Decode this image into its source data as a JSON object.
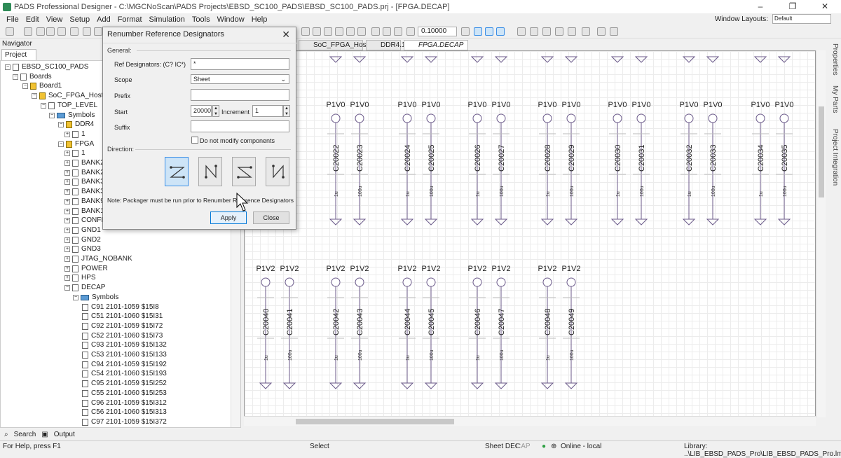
{
  "window": {
    "title": "PADS Professional Designer - C:\\MGCNoScan\\PADS Projects\\EBSD_SC100_PADS\\EBSD_SC100_PADS.prj - [FPGA.DECAP]",
    "minimize": "–",
    "maximize": "❐",
    "close": "✕"
  },
  "menu": [
    "File",
    "Edit",
    "View",
    "Setup",
    "Add",
    "Format",
    "Simulation",
    "Tools",
    "Window",
    "Help"
  ],
  "window_layouts": {
    "label": "Window Layouts:",
    "value": "Default"
  },
  "toolbar": {
    "zoom_value": "0.10000"
  },
  "navigator": {
    "title": "Navigator",
    "tab": "Project",
    "search_label": "Search",
    "output_label": "Output",
    "tree": [
      {
        "label": "EBSD_SC100_PADS",
        "indent": 0,
        "tw": "−",
        "icon": "project"
      },
      {
        "label": "Boards",
        "indent": 1,
        "tw": "−",
        "icon": "folder"
      },
      {
        "label": "Board1",
        "indent": 2,
        "tw": "−",
        "icon": "board"
      },
      {
        "label": "SoC_FPGA_Host",
        "indent": 3,
        "tw": "−",
        "icon": "block"
      },
      {
        "label": "TOP_LEVEL",
        "indent": 4,
        "tw": "−",
        "icon": "sheet"
      },
      {
        "label": "Symbols",
        "indent": 5,
        "tw": "−",
        "icon": "symbols"
      },
      {
        "label": "DDR4",
        "indent": 6,
        "tw": "−",
        "icon": "block"
      },
      {
        "label": "1",
        "indent": 7,
        "tw": "+",
        "icon": "sheet"
      },
      {
        "label": "FPGA",
        "indent": 6,
        "tw": "−",
        "icon": "block"
      },
      {
        "label": "1",
        "indent": 7,
        "tw": "+",
        "icon": "sheet"
      },
      {
        "label": "BANK2_",
        "indent": 7,
        "tw": "+",
        "icon": "sheet"
      },
      {
        "label": "BANK2_",
        "indent": 7,
        "tw": "+",
        "icon": "sheet"
      },
      {
        "label": "BANK3_",
        "indent": 7,
        "tw": "+",
        "icon": "sheet"
      },
      {
        "label": "BANK3_",
        "indent": 7,
        "tw": "+",
        "icon": "sheet"
      },
      {
        "label": "BANK9",
        "indent": 7,
        "tw": "+",
        "icon": "sheet"
      },
      {
        "label": "BANK10",
        "indent": 7,
        "tw": "+",
        "icon": "sheet"
      },
      {
        "label": "CONFIG",
        "indent": 7,
        "tw": "+",
        "icon": "sheet"
      },
      {
        "label": "GND1",
        "indent": 7,
        "tw": "+",
        "icon": "sheet"
      },
      {
        "label": "GND2",
        "indent": 7,
        "tw": "+",
        "icon": "sheet"
      },
      {
        "label": "GND3",
        "indent": 7,
        "tw": "+",
        "icon": "sheet"
      },
      {
        "label": "JTAG_NOBANK",
        "indent": 7,
        "tw": "+",
        "icon": "sheet"
      },
      {
        "label": "POWER",
        "indent": 7,
        "tw": "+",
        "icon": "sheet"
      },
      {
        "label": "HPS",
        "indent": 7,
        "tw": "+",
        "icon": "sheet"
      },
      {
        "label": "DECAP",
        "indent": 7,
        "tw": "−",
        "icon": "sheet"
      },
      {
        "label": "Symbols",
        "indent": 8,
        "tw": "−",
        "icon": "symbols"
      },
      {
        "label": "C91 2101-1059 $15I8",
        "indent": 9,
        "tw": "",
        "icon": "cap"
      },
      {
        "label": "C51 2101-1060 $15I31",
        "indent": 9,
        "tw": "",
        "icon": "cap"
      },
      {
        "label": "C92 2101-1059 $15I72",
        "indent": 9,
        "tw": "",
        "icon": "cap"
      },
      {
        "label": "C52 2101-1060 $15I73",
        "indent": 9,
        "tw": "",
        "icon": "cap"
      },
      {
        "label": "C93 2101-1059 $15I132",
        "indent": 9,
        "tw": "",
        "icon": "cap"
      },
      {
        "label": "C53 2101-1060 $15I133",
        "indent": 9,
        "tw": "",
        "icon": "cap"
      },
      {
        "label": "C94 2101-1059 $15I192",
        "indent": 9,
        "tw": "",
        "icon": "cap"
      },
      {
        "label": "C54 2101-1060 $15I193",
        "indent": 9,
        "tw": "",
        "icon": "cap"
      },
      {
        "label": "C95 2101-1059 $15I252",
        "indent": 9,
        "tw": "",
        "icon": "cap"
      },
      {
        "label": "C55 2101-1060 $15I253",
        "indent": 9,
        "tw": "",
        "icon": "cap"
      },
      {
        "label": "C96 2101-1059 $15I312",
        "indent": 9,
        "tw": "",
        "icon": "cap"
      },
      {
        "label": "C56 2101-1060 $15I313",
        "indent": 9,
        "tw": "",
        "icon": "cap"
      },
      {
        "label": "C97 2101-1059 $15I372",
        "indent": 9,
        "tw": "",
        "icon": "cap"
      }
    ]
  },
  "doc_tabs": [
    {
      "label": "SoC_FPGA_Hos...",
      "active": false
    },
    {
      "label": "DDR4.1",
      "active": false
    },
    {
      "label": "FPGA.DECAP",
      "active": true,
      "close": "×"
    }
  ],
  "schematic": {
    "row1": [
      {
        "net": "P1V0",
        "ref": "C20022",
        "val": "1u"
      },
      {
        "net": "P1V0",
        "ref": "C20023",
        "val": "100u"
      },
      {
        "net": "P1V0",
        "ref": "C20024",
        "val": "1u"
      },
      {
        "net": "P1V0",
        "ref": "C20025",
        "val": "100u"
      },
      {
        "net": "P1V0",
        "ref": "C20026",
        "val": "1u"
      },
      {
        "net": "P1V0",
        "ref": "C20027",
        "val": "100u"
      },
      {
        "net": "P1V0",
        "ref": "C20028",
        "val": "1u"
      },
      {
        "net": "P1V0",
        "ref": "C20029",
        "val": "100u"
      },
      {
        "net": "P1V0",
        "ref": "C20030",
        "val": "1u"
      },
      {
        "net": "P1V0",
        "ref": "C20031",
        "val": "100u"
      },
      {
        "net": "P1V0",
        "ref": "C20032",
        "val": "1u"
      },
      {
        "net": "P1V0",
        "ref": "C20033",
        "val": "100u"
      },
      {
        "net": "P1V0",
        "ref": "C20034",
        "val": "1u"
      },
      {
        "net": "P1V0",
        "ref": "C20035",
        "val": "100u"
      }
    ],
    "row2": [
      {
        "net": "P1V2",
        "ref": "C20040",
        "val": "1u"
      },
      {
        "net": "P1V2",
        "ref": "C20041",
        "val": "100u"
      },
      {
        "net": "P1V2",
        "ref": "C20042",
        "val": "1u"
      },
      {
        "net": "P1V2",
        "ref": "C20043",
        "val": "100u"
      },
      {
        "net": "P1V2",
        "ref": "C20044",
        "val": "1u"
      },
      {
        "net": "P1V2",
        "ref": "C20045",
        "val": "100u"
      },
      {
        "net": "P1V2",
        "ref": "C20046",
        "val": "1u"
      },
      {
        "net": "P1V2",
        "ref": "C20047",
        "val": "100u"
      },
      {
        "net": "P1V2",
        "ref": "C20048",
        "val": "1u"
      },
      {
        "net": "P1V2",
        "ref": "C20049",
        "val": "100u"
      }
    ]
  },
  "right_panels": [
    "Properties",
    "My Parts",
    "Project Integration"
  ],
  "dialog": {
    "title": "Renumber Reference Designators",
    "close": "✕",
    "general_label": "General:",
    "ref_designators_label": "Ref Designators: (C? IC*)",
    "ref_designators_value": "*",
    "scope_label": "Scope",
    "scope_value": "Sheet",
    "prefix_label": "Prefix",
    "prefix_value": "",
    "start_label": "Start",
    "start_value": "20000",
    "increment_label": "Increment",
    "increment_value": "1",
    "suffix_label": "Suffix",
    "suffix_value": "",
    "do_not_modify_label": "Do not modify components",
    "direction_label": "Direction:",
    "note": "Note: Packager must be run prior to Renumber Reference Designators",
    "apply_label": "Apply",
    "close_label": "Close"
  },
  "status": {
    "help": "For Help, press F1",
    "mode": "Select",
    "sheet": "Sheet DEC",
    "caps": "CAP",
    "online": "Online - local",
    "library": "Library: ..\\LIB_EBSD_PADS_Pro\\LIB_EBSD_PADS_Pro.lmc"
  }
}
